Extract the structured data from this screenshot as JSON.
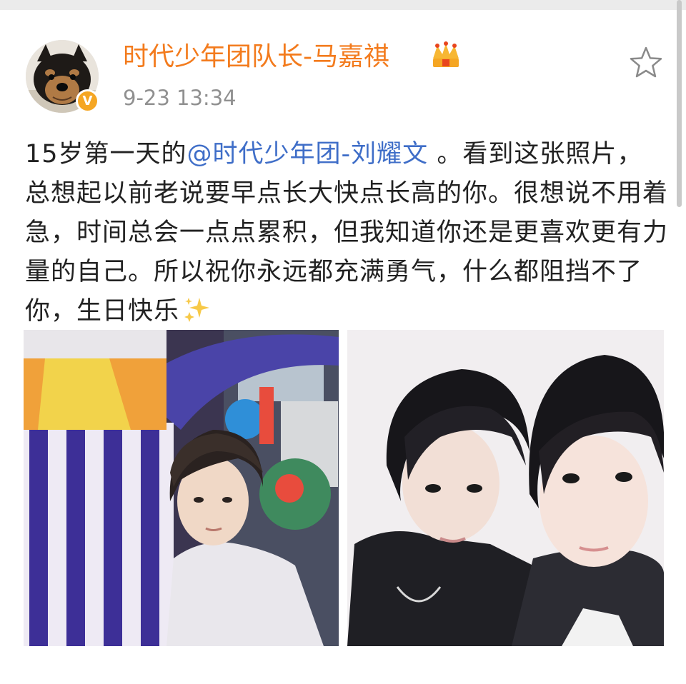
{
  "post": {
    "author": "时代少年团队长-马嘉祺",
    "timestamp": "9-23 13:34",
    "text_before_mention": "15岁第一天的",
    "mention": "@时代少年团-刘耀文",
    "text_after_mention": " 。看到这张照片，总想起以前老说要早点长大快点长高的你。很想说不用着急，时间总会一点点累积，但我知道你还是更喜欢更有力量的自己。所以祝你永远都充满勇气，什么都阻挡不了你，生日快乐",
    "verified_badge_letter": "V",
    "verified_badge_color": "#f5a623",
    "username_color": "#f37b1d",
    "mention_color": "#3f6ec8"
  },
  "icons": {
    "crown": "crown-icon",
    "star": "star-outline-icon",
    "sparkle": "sparkles-emoji"
  },
  "photos": [
    {
      "name": "photo-left",
      "subject": "boy in white hoodie beside striped inflatable"
    },
    {
      "name": "photo-right",
      "subject": "two boys selfie"
    }
  ]
}
